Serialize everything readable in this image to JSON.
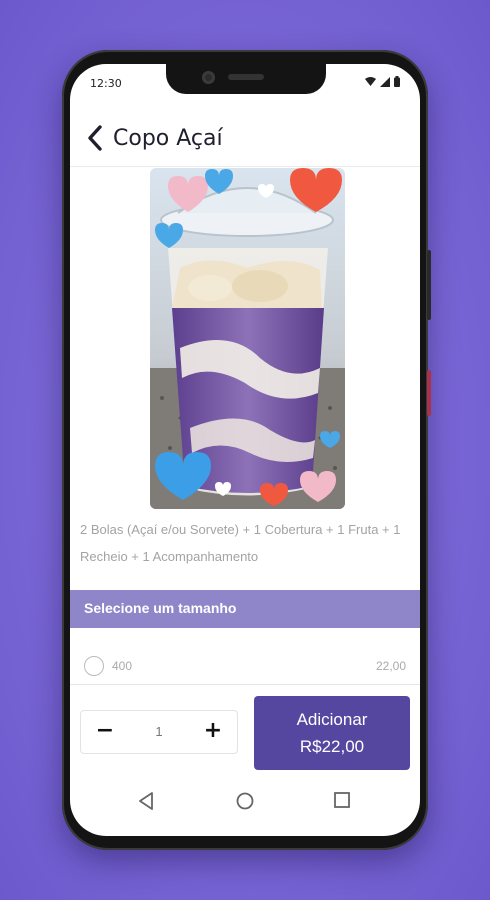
{
  "status_bar": {
    "time": "12:30"
  },
  "header": {
    "title": "Copo Açaí"
  },
  "product": {
    "description": "2 Bolas (Açaí e/ou Sorvete) + 1 Cobertura + 1 Fruta + 1 Recheio + 1 Acompanhamento"
  },
  "size_section": {
    "title": "Selecione um tamanho",
    "options": [
      {
        "label": "400",
        "price": "22,00"
      }
    ]
  },
  "quantity": {
    "value": "1",
    "decrement": "−",
    "increment": "+"
  },
  "add_button": {
    "line1": "Adicionar",
    "line2": "R$22,00"
  },
  "colors": {
    "background": "#7a67d6",
    "primary": "#55479f",
    "section_bar": "#8f86c9",
    "title_text": "#1f1f2e"
  },
  "icons": [
    "back-arrow-icon",
    "wifi-icon",
    "signal-icon",
    "battery-icon",
    "nav-back-icon",
    "nav-home-icon",
    "nav-recents-icon"
  ]
}
